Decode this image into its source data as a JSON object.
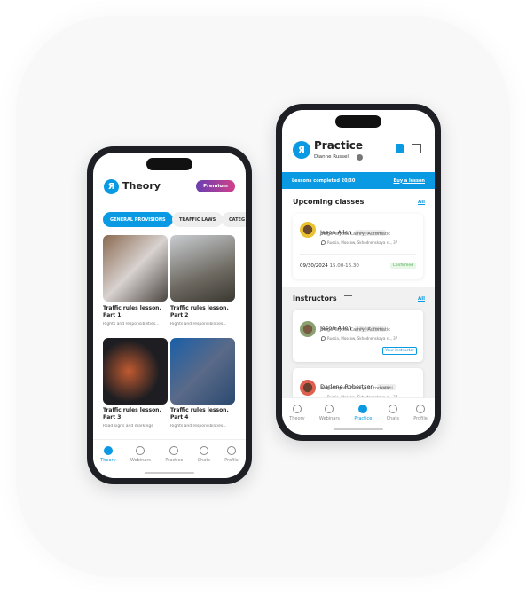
{
  "theory": {
    "title": "Theory",
    "premium": "Premium",
    "chips": [
      "GENERAL PROVISIONS",
      "TRAFFIC LAWS",
      "CATEG"
    ],
    "cards": [
      {
        "title": "Traffic rules lesson. Part 1",
        "sub": "Rights and responsibilities..."
      },
      {
        "title": "Traffic rules lesson. Part 2",
        "sub": "Rights and responsibilities..."
      },
      {
        "title": "Traffic rules lesson. Part 3",
        "sub": "Road signs and markings"
      },
      {
        "title": "Traffic rules lesson. Part 4",
        "sub": "Rights and responsibilities..."
      }
    ]
  },
  "practice": {
    "title": "Practice",
    "user": "Dianne Russell",
    "banner": "Lessons completed 20/30",
    "buy": "Buy a lesson",
    "upcoming": "Upcoming classes",
    "all": "All",
    "class": {
      "name": "Jason Allen",
      "tag": "I do not smoke",
      "car": "Beige Toyota Camry| Automatic",
      "addr": "Russia, Moscow, Skhodnenskaya st., 37",
      "date": "09/30/2024",
      "time": "15.00-16.30",
      "status": "Confirmed"
    },
    "instructors_title": "Instructors",
    "instructors": [
      {
        "name": "Jason Allen",
        "tag": "I do not smoke",
        "car": "Beige Toyota Camry| Automatic",
        "addr": "Russia, Moscow, Skhodnenskaya st., 37",
        "badge": "Your instructor"
      },
      {
        "name": "Darlene Robertson",
        "tag": "Smokes",
        "car": "Beige Toyota Camry| Automatic",
        "addr": "Russia, Moscow, Skhodnenskaya st., 37"
      }
    ]
  },
  "nav": [
    "Theory",
    "Webinars",
    "Practice",
    "Chats",
    "Profile"
  ],
  "colors": {
    "accent": "#0a9ae3",
    "premium_from": "#6a3fb0",
    "premium_to": "#d0408a",
    "confirmed": "#4caf50"
  }
}
